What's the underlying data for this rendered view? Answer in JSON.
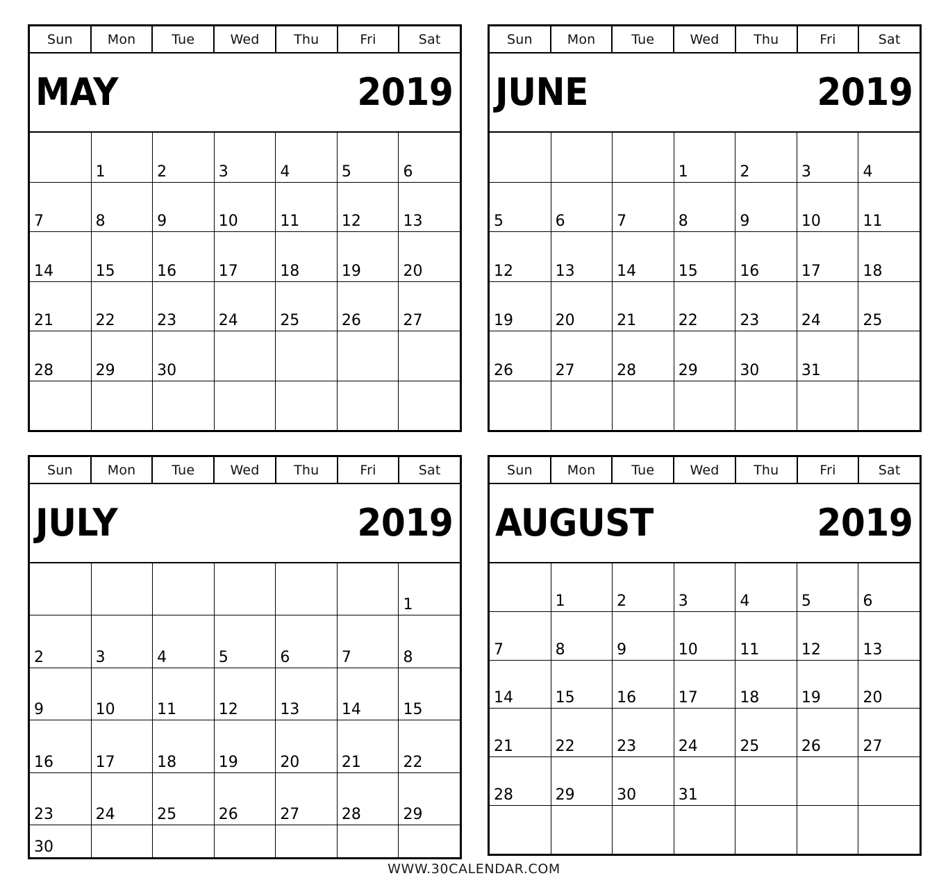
{
  "footer": {
    "site": "WWW.30CALENDAR.COM"
  },
  "weekdays": [
    "Sun",
    "Mon",
    "Tue",
    "Wed",
    "Thu",
    "Fri",
    "Sat"
  ],
  "calendars": [
    {
      "id": "may",
      "month": "MAY",
      "year": "2019",
      "weeks": [
        [
          "",
          "1",
          "2",
          "3",
          "4",
          "5",
          "6"
        ],
        [
          "7",
          "8",
          "9",
          "10",
          "11",
          "12",
          "13"
        ],
        [
          "14",
          "15",
          "16",
          "17",
          "18",
          "19",
          "20"
        ],
        [
          "21",
          "22",
          "23",
          "24",
          "25",
          "26",
          "27"
        ],
        [
          "28",
          "29",
          "30",
          "",
          "",
          "",
          ""
        ],
        [
          "",
          "",
          "",
          "",
          "",
          "",
          ""
        ]
      ]
    },
    {
      "id": "june",
      "month": "JUNE",
      "year": "2019",
      "weeks": [
        [
          "",
          "",
          "",
          "1",
          "2",
          "3",
          "4"
        ],
        [
          "5",
          "6",
          "7",
          "8",
          "9",
          "10",
          "11"
        ],
        [
          "12",
          "13",
          "14",
          "15",
          "16",
          "17",
          "18"
        ],
        [
          "19",
          "20",
          "21",
          "22",
          "23",
          "24",
          "25"
        ],
        [
          "26",
          "27",
          "28",
          "29",
          "30",
          "31",
          ""
        ],
        [
          "",
          "",
          "",
          "",
          "",
          "",
          ""
        ]
      ]
    },
    {
      "id": "july",
      "month": "JULY",
      "year": "2019",
      "weeks": [
        [
          "",
          "",
          "",
          "",
          "",
          "",
          "1"
        ],
        [
          "2",
          "3",
          "4",
          "5",
          "6",
          "7",
          "8"
        ],
        [
          "9",
          "10",
          "11",
          "12",
          "13",
          "14",
          "15"
        ],
        [
          "16",
          "17",
          "18",
          "19",
          "20",
          "21",
          "22"
        ],
        [
          "23",
          "24",
          "25",
          "26",
          "27",
          "28",
          "29"
        ],
        [
          "30",
          "",
          "",
          "",
          "",
          "",
          ""
        ]
      ]
    },
    {
      "id": "august",
      "month": "AUGUST",
      "year": "2019",
      "weeks": [
        [
          "",
          "1",
          "2",
          "3",
          "4",
          "5",
          "6"
        ],
        [
          "7",
          "8",
          "9",
          "10",
          "11",
          "12",
          "13"
        ],
        [
          "14",
          "15",
          "16",
          "17",
          "18",
          "19",
          "20"
        ],
        [
          "21",
          "22",
          "23",
          "24",
          "25",
          "26",
          "27"
        ],
        [
          "28",
          "29",
          "30",
          "31",
          "",
          "",
          ""
        ],
        [
          "",
          "",
          "",
          "",
          "",
          "",
          ""
        ]
      ]
    }
  ]
}
